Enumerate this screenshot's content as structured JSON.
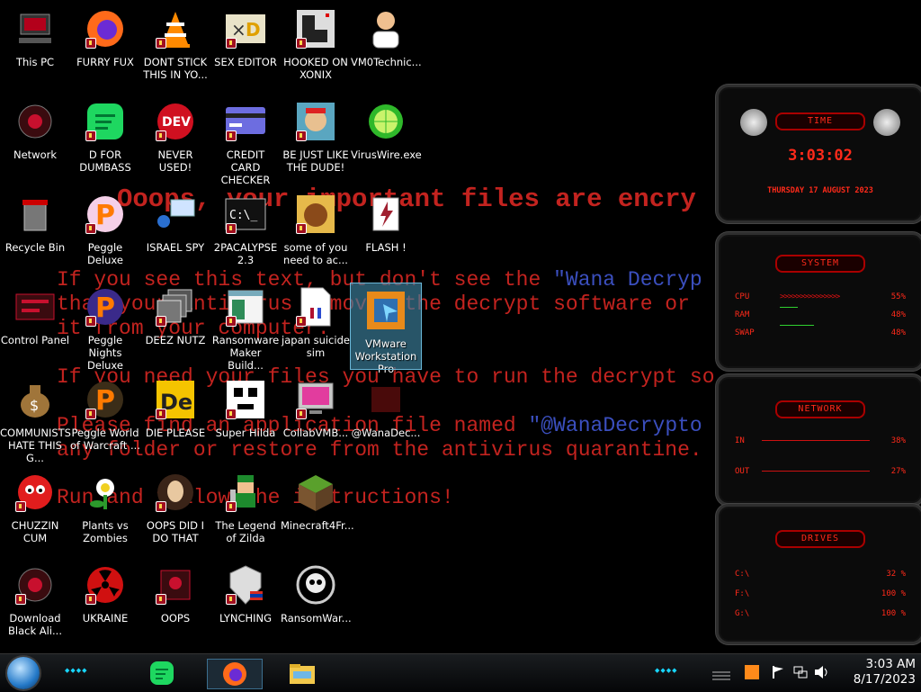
{
  "wallpaper": {
    "headline": "Ooops, your important files are encry",
    "l1a": "If you see this text, but don't see the ",
    "l1b": "\"Wana Decryp",
    "l2": "that your antivirus removed the decrypt software or",
    "l3": "it from your computer.",
    "l4": "If you need your files you have to run the decrypt so",
    "l5a": "Please find an application file named ",
    "l5b": "\"@WanaDecrypto",
    "l6": "any folder or restore from the antivirus quarantine.",
    "l7": "Run and follow the instructions!"
  },
  "icons": [
    {
      "label": "This PC"
    },
    {
      "label": "FURRY FUX"
    },
    {
      "label": "DONT STICK THIS IN YO..."
    },
    {
      "label": "SEX EDITOR"
    },
    {
      "label": "HOOKED ON XONIX"
    },
    {
      "label": "VM0Technic..."
    },
    {
      "label": "Network"
    },
    {
      "label": "D FOR DUMBASS"
    },
    {
      "label": "NEVER USED!"
    },
    {
      "label": "CREDIT CARD CHECKER"
    },
    {
      "label": "BE JUST LIKE THE DUDE!"
    },
    {
      "label": "VirusWire.exe"
    },
    {
      "label": "Recycle Bin"
    },
    {
      "label": "Peggle Deluxe"
    },
    {
      "label": "ISRAEL SPY"
    },
    {
      "label": "2PACALYPSE 2.3"
    },
    {
      "label": "some of you need to ac..."
    },
    {
      "label": "FLASH !"
    },
    {
      "label": "Control Panel"
    },
    {
      "label": "Peggle Nights Deluxe"
    },
    {
      "label": "DEEZ NUTZ"
    },
    {
      "label": "Ransomware Maker Build..."
    },
    {
      "label": "japan suicide sim"
    },
    {
      "label": "VMware Workstation Pro"
    },
    {
      "label": "COMMUNISTS HATE THIS G..."
    },
    {
      "label": "Peggle World of Warcraft ..."
    },
    {
      "label": "DIE PLEASE"
    },
    {
      "label": "Super Hilda"
    },
    {
      "label": "CollabVMB..."
    },
    {
      "label": "@WanaDec..."
    },
    {
      "label": "CHUZZIN CUM"
    },
    {
      "label": "Plants vs Zombies"
    },
    {
      "label": "OOPS DID I DO THAT"
    },
    {
      "label": "The Legend of Zilda"
    },
    {
      "label": "Minecraft4Fr..."
    },
    {
      "label": "Download Black Ali..."
    },
    {
      "label": "UKRAINE"
    },
    {
      "label": "OOPS"
    },
    {
      "label": "LYNCHING"
    },
    {
      "label": "RansomWar..."
    }
  ],
  "gadgets": {
    "time": {
      "title": "TIME",
      "clock": "3:03:02",
      "date": "THURSDAY 17 AUGUST 2023"
    },
    "system": {
      "title": "SYSTEM",
      "cpu_label": "CPU",
      "cpu_value": "55%",
      "ram_label": "RAM",
      "ram_value": "48%",
      "swap_label": "SWAP",
      "swap_value": "48%"
    },
    "network": {
      "title": "NETWORK",
      "in_label": "IN",
      "in_value": "38%",
      "out_label": "OUT",
      "out_value": "27%"
    },
    "drives": {
      "title": "DRIVES",
      "c_label": "C:\\",
      "c_value": "32 %",
      "f_label": "F:\\",
      "f_value": "100 %",
      "g_label": "G:\\",
      "g_value": "100 %"
    }
  },
  "taskbar": {
    "time": "3:03 AM",
    "date": "8/17/2023"
  },
  "colors": {
    "ransom_red": "#c3231f",
    "ransom_blue": "#3b4fbf",
    "gadget_red": "#ff2a1a"
  }
}
